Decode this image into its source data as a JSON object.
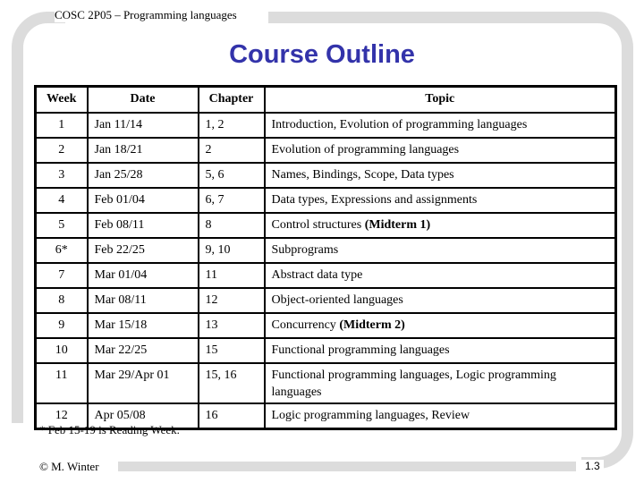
{
  "header": {
    "course": "COSC 2P05 – Programming languages"
  },
  "title": "Course Outline",
  "table": {
    "columns": [
      "Week",
      "Date",
      "Chapter",
      "Topic"
    ],
    "rows": [
      {
        "week": "1",
        "date": "Jan 11/14",
        "chapter": "1, 2",
        "topic": "Introduction, Evolution of programming languages",
        "note": ""
      },
      {
        "week": "2",
        "date": "Jan 18/21",
        "chapter": "2",
        "topic": "Evolution of programming languages",
        "note": ""
      },
      {
        "week": "3",
        "date": "Jan 25/28",
        "chapter": "5, 6",
        "topic": "Names, Bindings, Scope, Data types",
        "note": ""
      },
      {
        "week": "4",
        "date": "Feb 01/04",
        "chapter": "6, 7",
        "topic": "Data types, Expressions and assignments",
        "note": ""
      },
      {
        "week": "5",
        "date": "Feb 08/11",
        "chapter": "8",
        "topic": "Control structures ",
        "note": "(Midterm 1)"
      },
      {
        "week": "6*",
        "date": "Feb 22/25",
        "chapter": "9, 10",
        "topic": "Subprograms",
        "note": ""
      },
      {
        "week": "7",
        "date": "Mar 01/04",
        "chapter": "11",
        "topic": "Abstract data type",
        "note": ""
      },
      {
        "week": "8",
        "date": "Mar 08/11",
        "chapter": "12",
        "topic": "Object-oriented languages",
        "note": ""
      },
      {
        "week": "9",
        "date": "Mar 15/18",
        "chapter": "13",
        "topic": "Concurrency ",
        "note": "(Midterm 2)"
      },
      {
        "week": "10",
        "date": "Mar 22/25",
        "chapter": "15",
        "topic": "Functional programming languages",
        "note": ""
      },
      {
        "week": "11",
        "date": "Mar 29/Apr 01",
        "chapter": "15, 16",
        "topic": "Functional programming languages, Logic programming languages",
        "note": ""
      },
      {
        "week": "12",
        "date": "Apr 05/08",
        "chapter": "16",
        "topic": "Logic programming languages, Review",
        "note": ""
      }
    ]
  },
  "footnote": "* Feb 15-19 is Reading Week.",
  "footer": {
    "copyright": "© M. Winter",
    "page_number": "1.3"
  },
  "colors": {
    "title": "#3333aa",
    "frame": "#dcdcdc"
  }
}
